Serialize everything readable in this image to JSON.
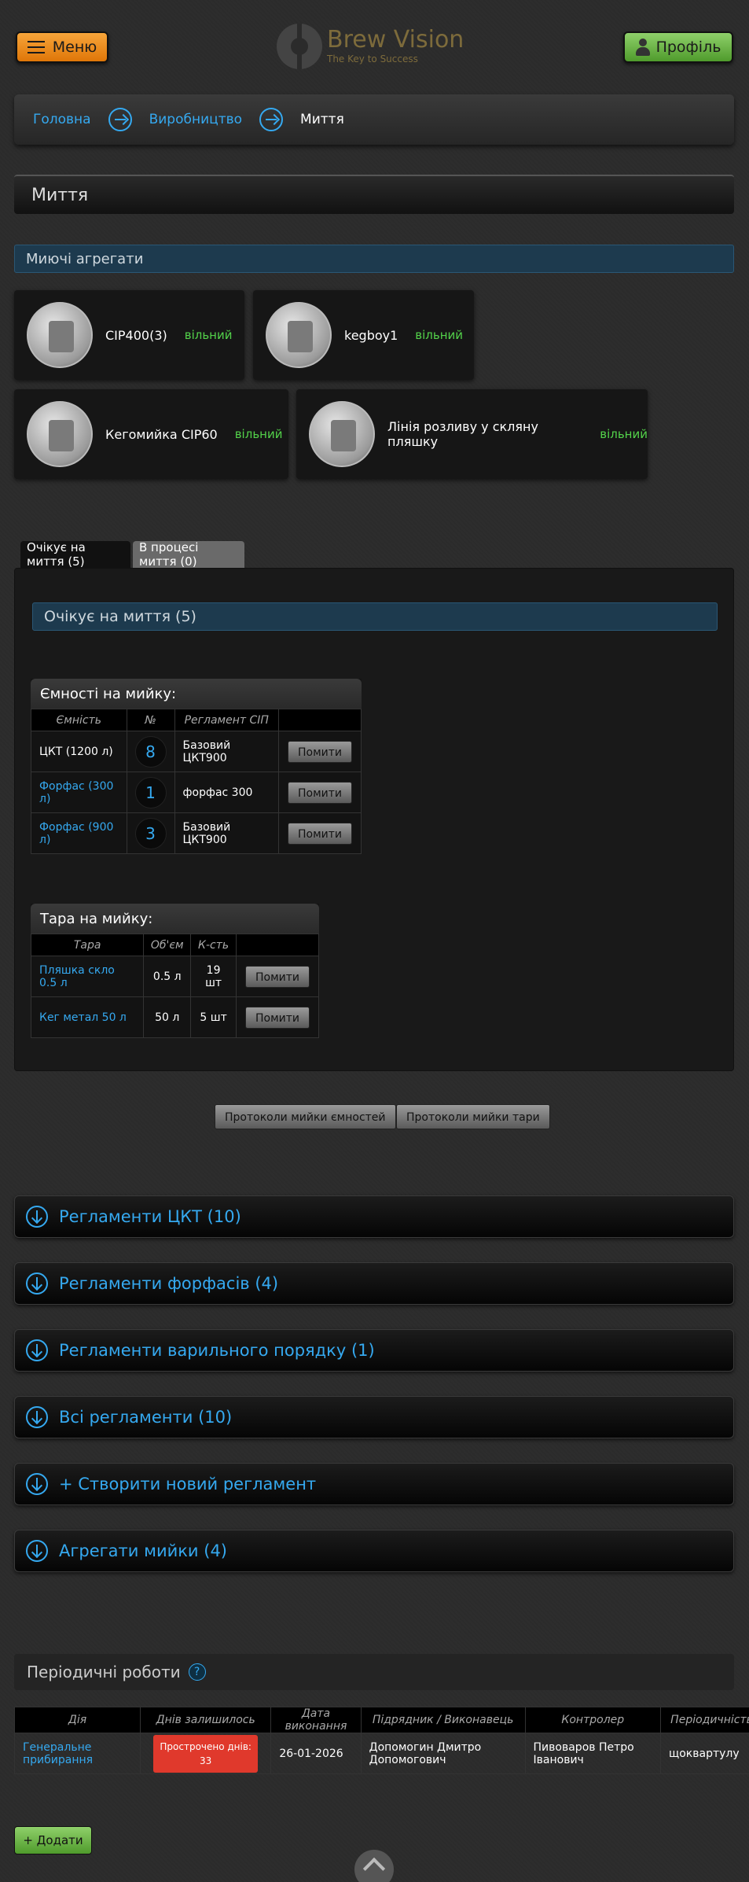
{
  "header": {
    "menu_label": "Меню",
    "profile_label": "Профіль",
    "logo_title": "Brew Vision",
    "logo_subtitle": "The Key to Success"
  },
  "breadcrumb": {
    "items": [
      "Головна",
      "Виробництво"
    ],
    "current": "Миття"
  },
  "page_title": "Миття",
  "machines_section": {
    "title": "Миючі агрегати",
    "items": [
      {
        "name": "CIP400(3)",
        "status": "вільний"
      },
      {
        "name": "kegboy1",
        "status": "вільний"
      },
      {
        "name": "Кегомийка CIP60",
        "status": "вільний"
      },
      {
        "name": "Лінія розливу у скляну пляшку",
        "status": "вільний"
      }
    ]
  },
  "tabs": [
    {
      "label": "Очікує на миття (5)",
      "active": true
    },
    {
      "label": "В процесі миття (0)",
      "active": false
    }
  ],
  "waiting_panel": {
    "title": "Очікує на миття (5)",
    "tanks": {
      "title": "Ємності на мийку:",
      "columns": [
        "Ємність",
        "№",
        "Регламент СІП",
        ""
      ],
      "rows": [
        {
          "tank": "ЦКТ (1200 л)",
          "link": false,
          "number": "8",
          "regulation": "Базовий ЦКТ900",
          "action": "Помити"
        },
        {
          "tank": "Форфас (300 л)",
          "link": true,
          "number": "1",
          "regulation": "форфас 300",
          "action": "Помити"
        },
        {
          "tank": "Форфас (900 л)",
          "link": true,
          "number": "3",
          "regulation": "Базовий ЦКТ900",
          "action": "Помити"
        }
      ]
    },
    "containers": {
      "title": "Тара на мийку:",
      "columns": [
        "Тара",
        "Об'єм",
        "К-сть",
        ""
      ],
      "rows": [
        {
          "name": "Пляшка скло 0.5 л",
          "volume": "0.5 л",
          "qty": "19 шт",
          "action": "Помити"
        },
        {
          "name": "Кег метал 50 л",
          "volume": "50 л",
          "qty": "5 шт",
          "action": "Помити"
        }
      ]
    }
  },
  "protocol_buttons": {
    "tanks": "Протоколи мийки ємностей",
    "containers": "Протоколи мийки тари"
  },
  "accordions": [
    "Регламенти ЦКТ (10)",
    "Регламенти форфасів (4)",
    "Регламенти варильного порядку (1)",
    "Всі регламенти (10)",
    "+ Створити новий регламент",
    "Агрегати мийки (4)"
  ],
  "periodic": {
    "title": "Періодичні роботи",
    "help": "?",
    "columns": [
      "Дія",
      "Днів залишилось",
      "Дата виконання",
      "Підрядник / Виконавець",
      "Контролер",
      "Періодичність"
    ],
    "rows": [
      {
        "action": "Генеральне прибирання",
        "days_left_line1": "Прострочено днів:",
        "days_left_line2": "33",
        "date": "26-01-2026",
        "contractor": "Допомогин Дмитро Допомогович",
        "controller": "Пивоваров Петро Іванович",
        "periodicity": "щоквартулу"
      }
    ],
    "add_label": "+ Додати"
  },
  "colors": {
    "accent": "#35a9f0",
    "status_free": "#53d24a",
    "overdue": "#e0392c",
    "menu_orange": "#f0901c",
    "profile_green": "#6fbf4a"
  }
}
